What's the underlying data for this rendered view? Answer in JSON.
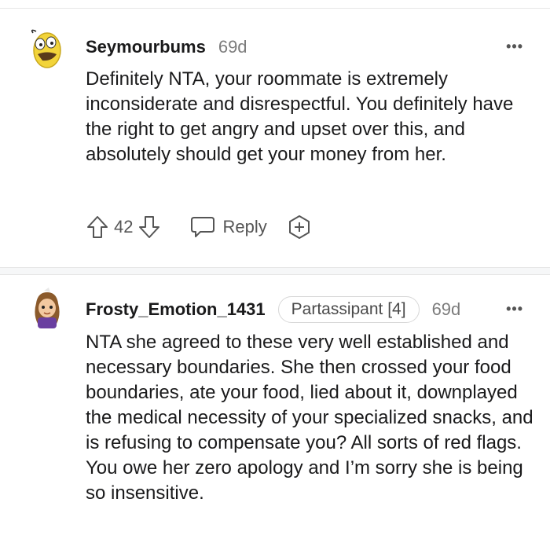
{
  "comments": [
    {
      "username": "Seymourbums",
      "age": "69d",
      "more": "•••",
      "body": "Definitely NTA, your roommate is extremely inconsiderate and disrespectful. You definitely have the right to get angry and upset over this, and absolutely should get your money from her.",
      "score": "42",
      "reply_label": "Reply"
    },
    {
      "username": "Frosty_Emotion_1431",
      "flair": "Partassipant [4]",
      "age": "69d",
      "more": "•••",
      "body": "NTA she agreed to these very well established and necessary boundaries. She then crossed your food boundaries, ate your food, lied about it, downplayed the medical necessity of your specialized snacks, and is refusing to compensate you? All sorts of red flags. You owe her zero apology and I’m sorry she is being so insensitive."
    }
  ],
  "colors": {
    "text": "#1a1a1b",
    "muted": "#7c7c7c",
    "divider": "#e6e6e6",
    "avatar1": "#f2d43a",
    "avatar2": "#8b5a2b"
  }
}
